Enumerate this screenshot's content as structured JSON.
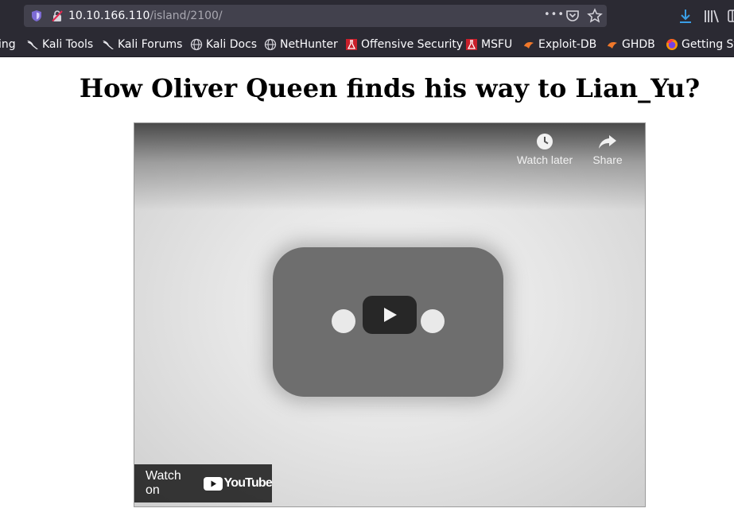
{
  "browser": {
    "url_host": "10.10.166.110",
    "url_path": "/island/2100/",
    "page_actions_glyph": "•••"
  },
  "bookmarks": [
    {
      "label": "ing",
      "icon": "none"
    },
    {
      "label": "Kali Tools",
      "icon": "kali-dragon-icon"
    },
    {
      "label": "Kali Forums",
      "icon": "kali-dragon-icon"
    },
    {
      "label": "Kali Docs",
      "icon": "globe-icon"
    },
    {
      "label": "NetHunter",
      "icon": "globe-icon"
    },
    {
      "label": "Offensive Security",
      "icon": "offsec-flask-icon"
    },
    {
      "label": "MSFU",
      "icon": "offsec-flask-icon"
    },
    {
      "label": "Exploit-DB",
      "icon": "exploitdb-bug-icon"
    },
    {
      "label": "GHDB",
      "icon": "exploitdb-bug-icon"
    },
    {
      "label": "Getting St",
      "icon": "firefox-icon"
    }
  ],
  "page": {
    "title": "How Oliver Queen finds his way to Lian_Yu?"
  },
  "video": {
    "watch_later_label": "Watch later",
    "share_label": "Share",
    "watch_on_label": "Watch on",
    "youtube_logo_text": "YouTube"
  },
  "colors": {
    "toolbar_bg": "#2b2a33",
    "urlbar_bg": "#42414d",
    "download_accent": "#3a9ee6"
  }
}
